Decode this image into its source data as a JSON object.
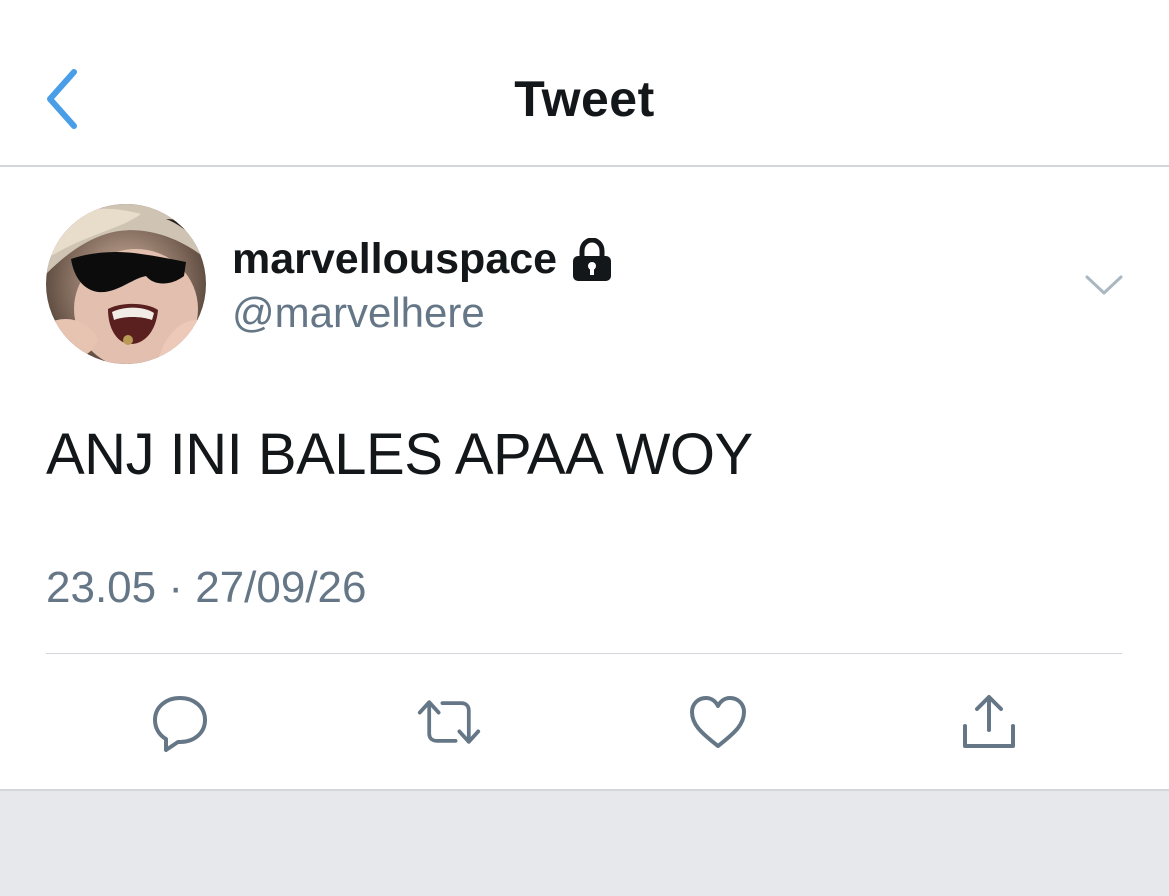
{
  "header": {
    "title": "Tweet"
  },
  "tweet": {
    "display_name": "marvellouspace",
    "handle": "@marvelhere",
    "text": "ANJ INI BALES APAA WOY",
    "timestamp": "23.05 · 27/09/26",
    "locked": true
  },
  "icons": {
    "back": "chevron-left-icon",
    "lock": "lock-icon",
    "caret": "chevron-down-icon",
    "reply": "reply-icon",
    "retweet": "retweet-icon",
    "like": "heart-icon",
    "share": "share-icon"
  },
  "colors": {
    "accent": "#4a9ee8",
    "text_primary": "#14171a",
    "text_secondary": "#657786",
    "divider": "#d3d6da",
    "footer_bg": "#e6e8ec"
  }
}
